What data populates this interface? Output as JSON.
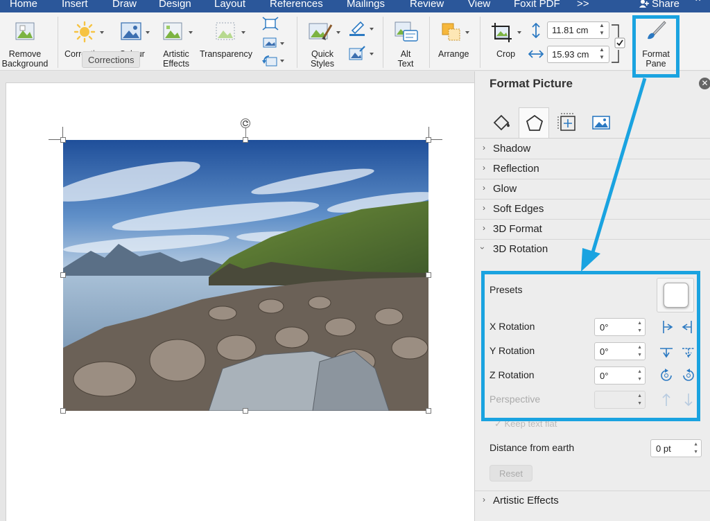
{
  "menu_tabs": [
    "Home",
    "Insert",
    "Draw",
    "Design",
    "Layout",
    "References",
    "Mailings",
    "Review",
    "View",
    "Foxit PDF",
    ">>"
  ],
  "share_label": "Share",
  "ribbon": {
    "remove_background": "Remove\nBackground",
    "corrections": "Corrections",
    "colour": "Colour",
    "artistic_effects": "Artistic\nEffects",
    "transparency": "Transparency",
    "quick_styles": "Quick\nStyles",
    "alt_text": "Alt\nText",
    "arrange": "Arrange",
    "crop": "Crop",
    "height": "11.81 cm",
    "width": "15.93 cm",
    "format_pane": "Format\nPane",
    "tooltip": "Corrections"
  },
  "pane": {
    "title": "Format Picture",
    "sections_top": [
      "Shadow",
      "Reflection",
      "Glow",
      "Soft Edges",
      "3D Format",
      "3D Rotation"
    ],
    "presets_label": "Presets",
    "x_rotation_label": "X Rotation",
    "x_rotation_value": "0°",
    "y_rotation_label": "Y Rotation",
    "y_rotation_value": "0°",
    "z_rotation_label": "Z Rotation",
    "z_rotation_value": "0°",
    "perspective_label": "Perspective",
    "keep_text_flat": "Keep text flat",
    "distance_label": "Distance from earth",
    "distance_value": "0 pt",
    "reset_label": "Reset",
    "artistic_effects": "Artistic Effects"
  },
  "colors": {
    "accent": "#1aa3e0",
    "tabbar": "#2b579a"
  }
}
